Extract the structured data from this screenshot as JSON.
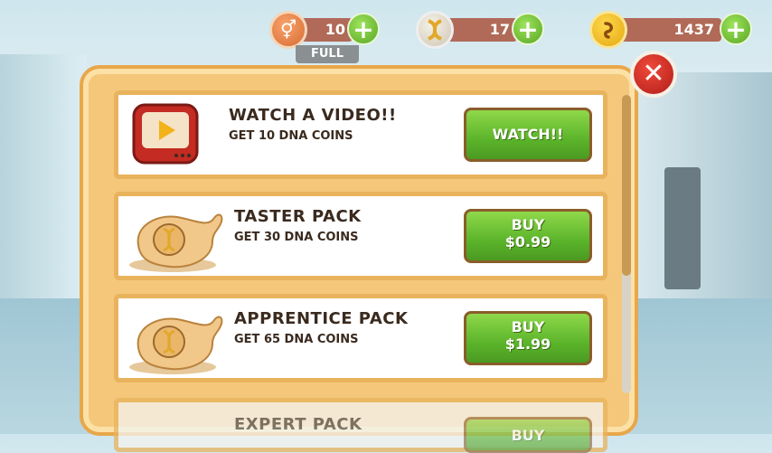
{
  "resources": {
    "gender": {
      "icon": "gender-symbol-icon",
      "value": "10",
      "status": "FULL"
    },
    "dna": {
      "icon": "dna-icon",
      "value": "17"
    },
    "coins": {
      "icon": "coin-icon",
      "value": "1437"
    },
    "plus_label": "+"
  },
  "panel": {
    "close_label": "✕",
    "offers": [
      {
        "title": "WATCH A VIDEO!!",
        "subtitle": "GET 10 DNA COINS",
        "button": "WATCH!!",
        "icon": "tv-play-icon"
      },
      {
        "title": "TASTER PACK",
        "subtitle": "GET 30 DNA COINS",
        "button_line1": "BUY",
        "button_line2": "$0.99",
        "icon": "dna-bag-icon"
      },
      {
        "title": "APPRENTICE PACK",
        "subtitle": "GET 65 DNA COINS",
        "button_line1": "BUY",
        "button_line2": "$1.99",
        "icon": "dna-bag-icon"
      },
      {
        "title": "EXPERT PACK",
        "button": "BUY",
        "icon": "dna-bag-icon"
      }
    ]
  },
  "colors": {
    "accent_green": "#5bb42a",
    "panel_orange": "#f4c77a",
    "close_red": "#d1281f",
    "pill_brown": "#b06a57"
  }
}
